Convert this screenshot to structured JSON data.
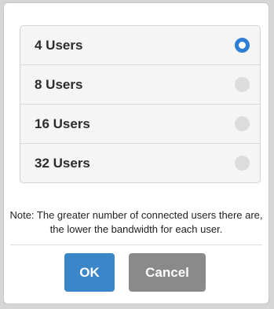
{
  "options": [
    {
      "label": "4 Users",
      "selected": true
    },
    {
      "label": "8 Users",
      "selected": false
    },
    {
      "label": "16 Users",
      "selected": false
    },
    {
      "label": "32 Users",
      "selected": false
    }
  ],
  "note": "Note: The greater number of connected users there are, the lower the bandwidth for each user.",
  "buttons": {
    "ok_label": "OK",
    "cancel_label": "Cancel"
  },
  "colors": {
    "accent": "#2d7ed4",
    "ok_button": "#3a86c8",
    "cancel_button": "#8a8a8a",
    "radio_unselected": "#dcdcdc"
  }
}
